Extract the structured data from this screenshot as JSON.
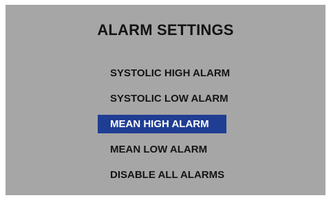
{
  "screen": {
    "title": "ALARM SETTINGS"
  },
  "menu": {
    "items": [
      {
        "label": "SYSTOLIC HIGH ALARM",
        "selected": false
      },
      {
        "label": "SYSTOLIC LOW ALARM",
        "selected": false
      },
      {
        "label": "MEAN HIGH ALARM",
        "selected": true
      },
      {
        "label": "MEAN LOW ALARM",
        "selected": false
      },
      {
        "label": "DISABLE ALL ALARMS",
        "selected": false
      }
    ]
  },
  "colors": {
    "screen_background": "#a6a6a6",
    "selection_highlight": "#1f3d93",
    "text": "#141414",
    "selected_text": "#ffffff"
  }
}
